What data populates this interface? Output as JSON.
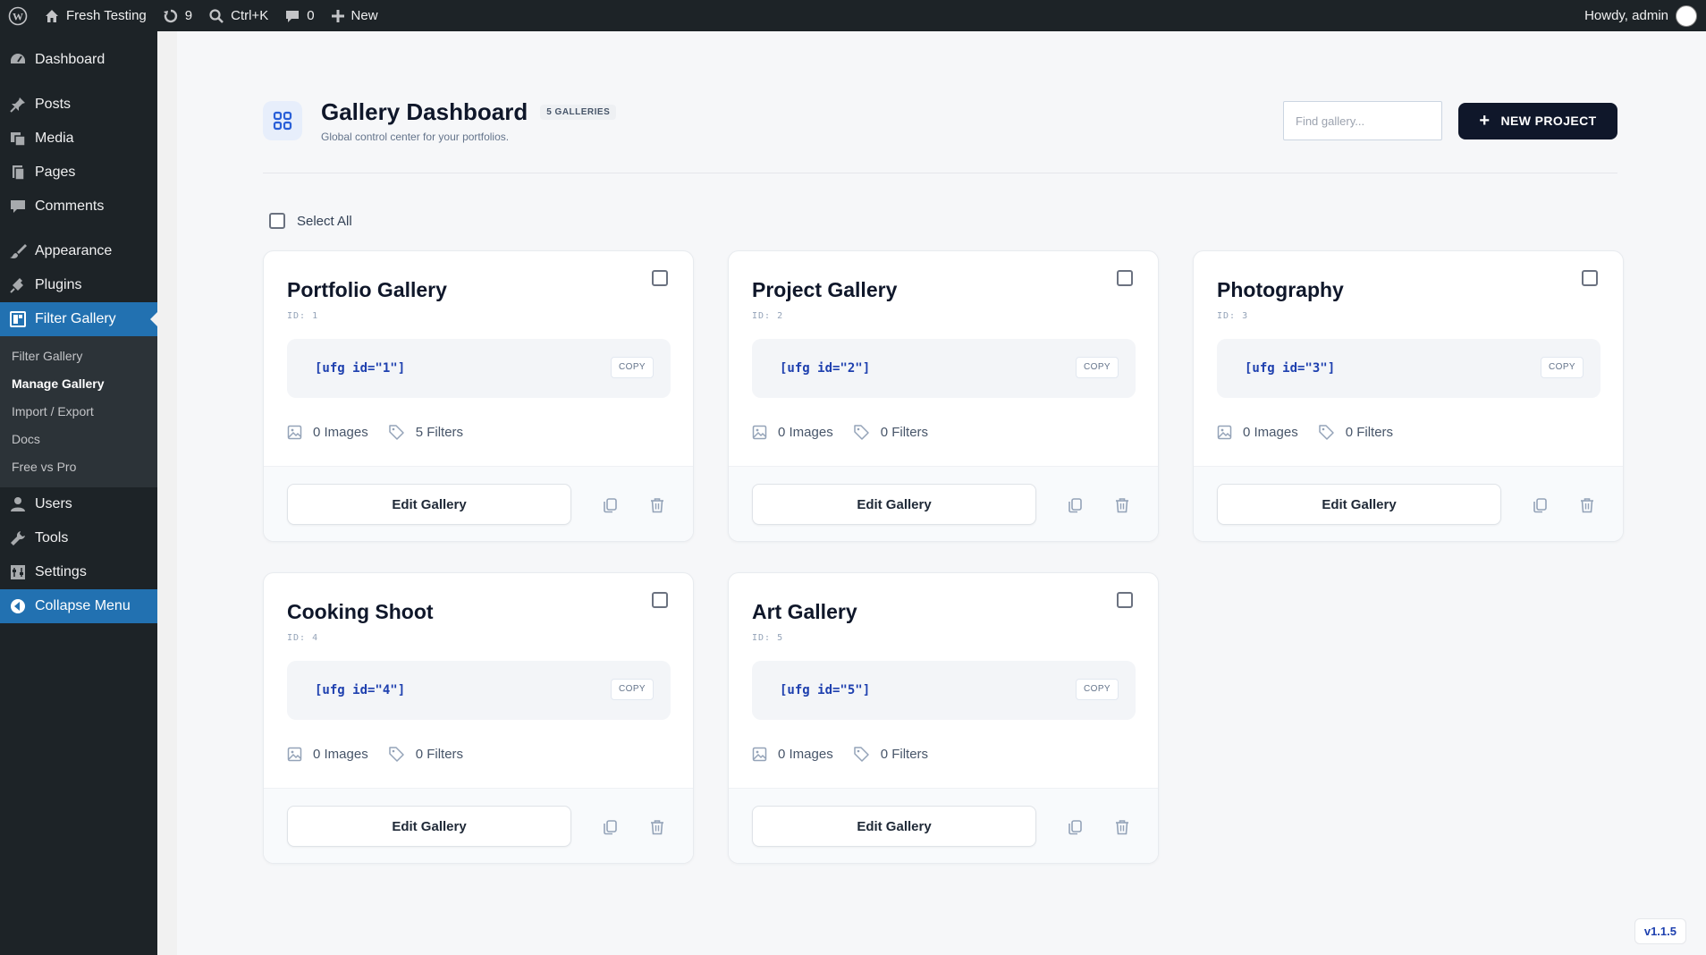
{
  "adminbar": {
    "site_name": "Fresh Testing",
    "updates_count": "9",
    "search_shortcut": "Ctrl+K",
    "comments_count": "0",
    "new_label": "New",
    "howdy": "Howdy, admin"
  },
  "sidebar": {
    "dashboard": "Dashboard",
    "posts": "Posts",
    "media": "Media",
    "pages": "Pages",
    "comments": "Comments",
    "appearance": "Appearance",
    "plugins": "Plugins",
    "filter_gallery": "Filter Gallery",
    "submenu": [
      "Filter Gallery",
      "Manage Gallery",
      "Import / Export",
      "Docs",
      "Free vs Pro"
    ],
    "users": "Users",
    "tools": "Tools",
    "settings": "Settings",
    "collapse": "Collapse Menu"
  },
  "header": {
    "title": "Gallery Dashboard",
    "count_badge": "5 GALLERIES",
    "subtitle": "Global control center for your portfolios.",
    "search_placeholder": "Find gallery...",
    "new_project": "NEW PROJECT"
  },
  "select_all": "Select All",
  "galleries": [
    {
      "title": "Portfolio Gallery",
      "id_label": "ID: 1",
      "shortcode": "[ufg id=\"1\"]",
      "copy": "COPY",
      "images": "0 Images",
      "filters": "5 Filters",
      "edit": "Edit Gallery"
    },
    {
      "title": "Project Gallery",
      "id_label": "ID: 2",
      "shortcode": "[ufg id=\"2\"]",
      "copy": "COPY",
      "images": "0 Images",
      "filters": "0 Filters",
      "edit": "Edit Gallery"
    },
    {
      "title": "Photography",
      "id_label": "ID: 3",
      "shortcode": "[ufg id=\"3\"]",
      "copy": "COPY",
      "images": "0 Images",
      "filters": "0 Filters",
      "edit": "Edit Gallery"
    },
    {
      "title": "Cooking Shoot",
      "id_label": "ID: 4",
      "shortcode": "[ufg id=\"4\"]",
      "copy": "COPY",
      "images": "0 Images",
      "filters": "0 Filters",
      "edit": "Edit Gallery"
    },
    {
      "title": "Art Gallery",
      "id_label": "ID: 5",
      "shortcode": "[ufg id=\"5\"]",
      "copy": "COPY",
      "images": "0 Images",
      "filters": "0 Filters",
      "edit": "Edit Gallery"
    }
  ],
  "version": "v1.1.5",
  "colors": {
    "accent": "#2271b1",
    "primary_dark": "#0f172a",
    "shortcode_blue": "#1e40af"
  }
}
